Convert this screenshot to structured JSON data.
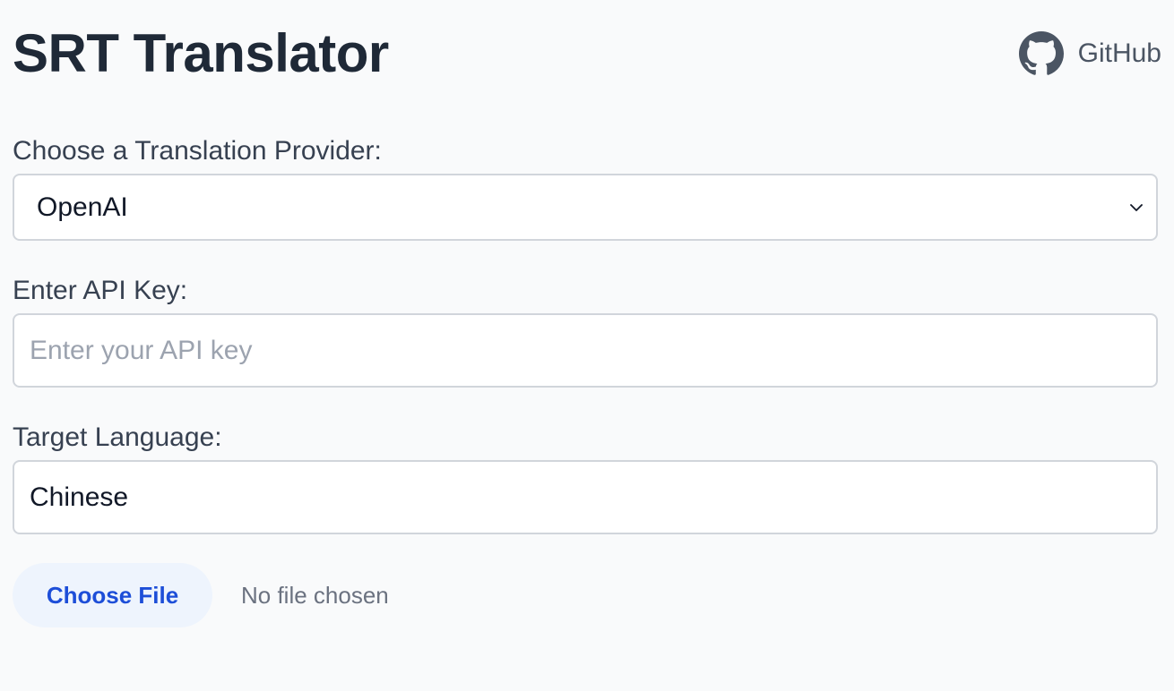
{
  "header": {
    "title": "SRT Translator",
    "github_label": "GitHub",
    "github_icon": "github-icon"
  },
  "provider": {
    "label": "Choose a Translation Provider:",
    "selected": "OpenAI"
  },
  "api_key": {
    "label": "Enter API Key:",
    "value": "",
    "placeholder": "Enter your API key"
  },
  "language": {
    "label": "Target Language:",
    "value": "Chinese"
  },
  "file": {
    "button_label": "Choose File",
    "status": "No file chosen"
  },
  "colors": {
    "background": "#f9fafb",
    "title": "#1f2937",
    "file_button_bg": "#eef4fd",
    "file_button_text": "#1d4ed8"
  }
}
